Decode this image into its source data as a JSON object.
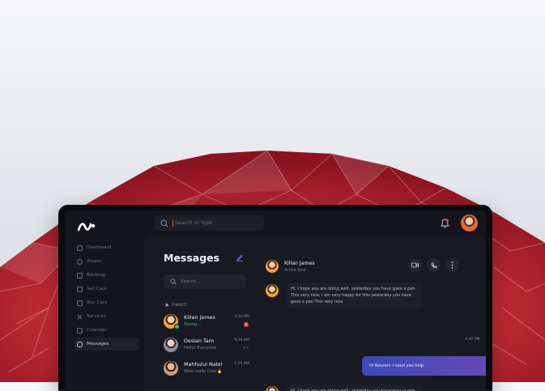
{
  "app": {
    "search_placeholder": "Search or type",
    "colors": {
      "accent": "#e0622c",
      "active_nav": "#1e2129",
      "outgoing_from": "#3a4bb8",
      "outgoing_to": "#6a49b8",
      "online": "#3fbf6a",
      "badge": "#e24a3b"
    }
  },
  "sidebar": {
    "items": [
      {
        "label": "Dashboard",
        "icon": "dashboard-icon"
      },
      {
        "label": "Assets",
        "icon": "assets-icon"
      },
      {
        "label": "Booking",
        "icon": "booking-icon"
      },
      {
        "label": "Sell Cars",
        "icon": "sell-cars-icon"
      },
      {
        "label": "Buy Cars",
        "icon": "buy-cars-icon"
      },
      {
        "label": "Services",
        "icon": "services-icon"
      },
      {
        "label": "Calender",
        "icon": "calendar-icon"
      },
      {
        "label": "Messages",
        "icon": "messages-icon"
      }
    ]
  },
  "messages": {
    "title": "Messages",
    "search_placeholder": "Search...",
    "pinned_label": "PINNED",
    "conversations": [
      {
        "name": "Killan James",
        "sub": "Typing...",
        "time": "4:30 PM",
        "badge": "2"
      },
      {
        "name": "Desian Tam",
        "sub": "Hello! Everyone",
        "time": "9:36 AM",
        "status": "✓✓"
      },
      {
        "name": "Mahfuzul Nabil",
        "sub": "Wow really Cool 🔥",
        "time": "1:15 AM"
      }
    ]
  },
  "chat": {
    "name": "Killan James",
    "status": "Active Now",
    "messages": [
      {
        "text": "Hi, I hope you are doing well, yesterday you have gave a pen This very nice, i am very happy for this.yesterday you have gave a pen This very nice",
        "time": "4:30 PM",
        "direction": "in"
      },
      {
        "text": "Hi Neuron! I need you help",
        "direction": "out"
      },
      {
        "text": "Hi, I hope you are doing well, yesterday you have gave a pen This very nice 😆",
        "direction": "in"
      }
    ]
  }
}
